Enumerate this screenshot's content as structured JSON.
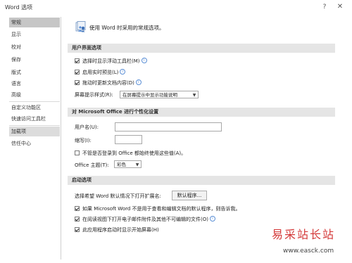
{
  "window": {
    "title": "Word 选项",
    "help": "?",
    "close": "✕"
  },
  "sidebar": {
    "items": [
      {
        "label": "常规"
      },
      {
        "label": "显示"
      },
      {
        "label": "校对"
      },
      {
        "label": "保存"
      },
      {
        "label": "版式"
      },
      {
        "label": "语言"
      },
      {
        "label": "高级"
      },
      {
        "label": "自定义功能区"
      },
      {
        "label": "快速访问工具栏"
      },
      {
        "label": "加载项"
      },
      {
        "label": "信任中心"
      }
    ]
  },
  "header": {
    "text": "使用 Word 时采用的常规选项。",
    "icon": "general-options-icon"
  },
  "ui_section": {
    "title": "用户界面选项",
    "mini_toolbar": "选择时显示浮动工具栏(M)",
    "live_preview": "启用实时预览(L)",
    "update_content": "拖动时更新文档内容(D)",
    "screentip_label": "屏幕提示样式(R):",
    "screentip_value": "在屏幕提示中显示功能说明"
  },
  "personalize_section": {
    "title": "对 Microsoft Office 进行个性化设置",
    "username_label": "用户名(U):",
    "username_value": "",
    "initials_label": "缩写(I):",
    "initials_value": "",
    "always_use": "不管是否登录到 Office 都始终使用这些值(A)。",
    "theme_label": "Office 主题(T):",
    "theme_value": "彩色"
  },
  "startup_section": {
    "title": "启动选项",
    "default_ext_label": "选择希望 Word 默认情况下打开扩展名:",
    "default_programs_btn": "默认程序...",
    "tell_me": "如果 Microsoft Word 不是用于查看和编辑文档的默认程序，则告诉我。",
    "reading_view": "在阅读视图下打开电子邮件附件及其他不可编辑的文件(O)",
    "start_screen": "此应用程序启动时显示开始屏幕(H)"
  },
  "watermark": {
    "text": "易采站长站",
    "url": "www.easck.com"
  }
}
